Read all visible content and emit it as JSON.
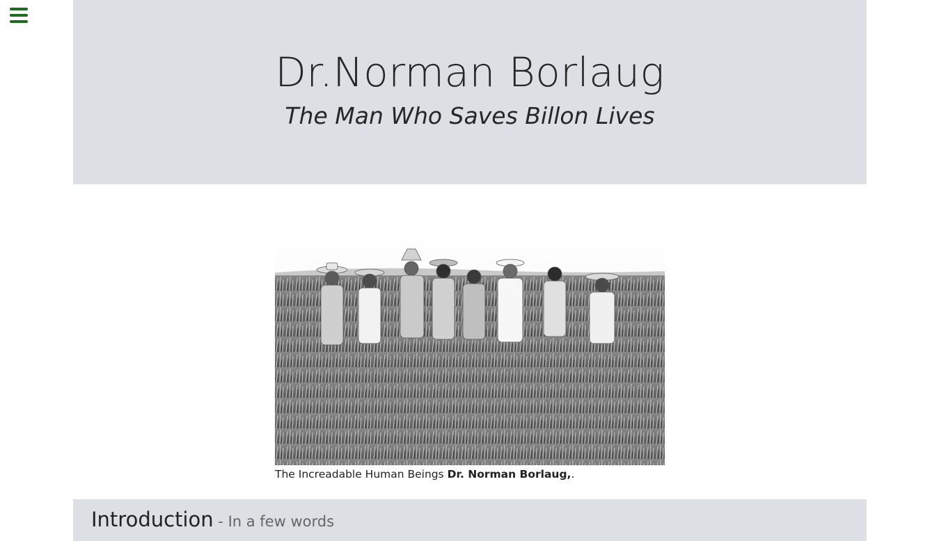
{
  "header": {
    "title": "Dr.Norman Borlaug",
    "subtitle": "The Man Who Saves Billon Lives"
  },
  "figure": {
    "image_alt": "Dr. Norman Borlaug with a group of men in a wheat field",
    "caption_prefix": "The Increadable Human Beings ",
    "caption_bold": "Dr. Norman Borlaug,",
    "caption_suffix": "."
  },
  "introduction": {
    "title": "Introduction",
    "subtitle_separator": " - ",
    "subtitle": "In a few words"
  },
  "colors": {
    "menu_icon": "#1f6b1f",
    "banner_bg": "#dcdfe3"
  }
}
